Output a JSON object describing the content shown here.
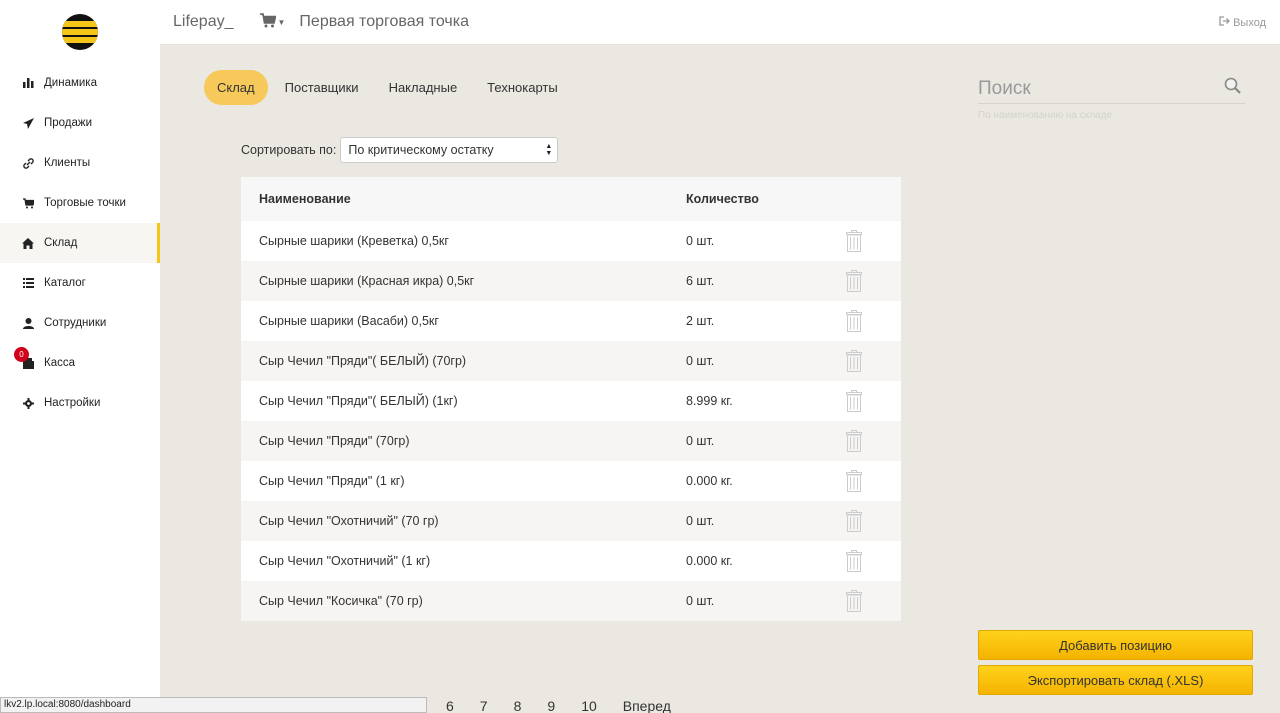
{
  "header": {
    "brand": "Lifepay_",
    "store_title": "Первая торговая точка",
    "logout_label": "Выход"
  },
  "sidebar": {
    "items": [
      {
        "label": "Динамика",
        "icon": "bar-chart-icon"
      },
      {
        "label": "Продажи",
        "icon": "paper-plane-icon"
      },
      {
        "label": "Клиенты",
        "icon": "link-icon"
      },
      {
        "label": "Торговые точки",
        "icon": "cart-icon"
      },
      {
        "label": "Склад",
        "icon": "home-icon",
        "active": true
      },
      {
        "label": "Каталог",
        "icon": "list-icon"
      },
      {
        "label": "Сотрудники",
        "icon": "user-icon"
      },
      {
        "label": "Касса",
        "icon": "register-icon",
        "badge": "0"
      },
      {
        "label": "Настройки",
        "icon": "gear-icon"
      }
    ]
  },
  "tabs": [
    {
      "label": "Склад",
      "active": true
    },
    {
      "label": "Поставщики"
    },
    {
      "label": "Накладные"
    },
    {
      "label": "Технокарты"
    }
  ],
  "sort": {
    "label": "Сортировать по:",
    "selected": "По критическому остатку"
  },
  "table": {
    "headers": {
      "name": "Наименование",
      "qty": "Количество"
    },
    "rows": [
      {
        "name": "Сырные шарики (Креветка) 0,5кг",
        "qty": "0 шт."
      },
      {
        "name": "Сырные шарики (Красная икра) 0,5кг",
        "qty": "6 шт."
      },
      {
        "name": "Сырные шарики (Васаби) 0,5кг",
        "qty": "2 шт."
      },
      {
        "name": "Сыр Чечил \"Пряди\"( БЕЛЫЙ) (70гр)",
        "qty": "0 шт."
      },
      {
        "name": "Сыр Чечил \"Пряди\"( БЕЛЫЙ) (1кг)",
        "qty": "8.999 кг."
      },
      {
        "name": "Сыр Чечил \"Пряди\" (70гр)",
        "qty": "0 шт."
      },
      {
        "name": "Сыр Чечил \"Пряди\" (1 кг)",
        "qty": "0.000 кг."
      },
      {
        "name": "Сыр Чечил \"Охотничий\" (70 гр)",
        "qty": "0 шт."
      },
      {
        "name": "Сыр Чечил \"Охотничий\" (1 кг)",
        "qty": "0.000 кг."
      },
      {
        "name": "Сыр Чечил \"Косичка\" (70 гр)",
        "qty": "0 шт."
      }
    ]
  },
  "search": {
    "placeholder": "Поиск",
    "hint": "По наименованию на складе"
  },
  "buttons": {
    "add": "Добавить позицию",
    "export": "Экспортировать склад (.XLS)"
  },
  "pagination": {
    "pages": [
      "6",
      "7",
      "8",
      "9",
      "10"
    ],
    "next": "Вперед"
  },
  "statusbar": {
    "url": "lkv2.lp.local:8080/dashboard"
  },
  "colors": {
    "accent": "#f5c518",
    "tab_active": "#f7c95a",
    "background": "#ebe8e2",
    "badge": "#d0021b"
  }
}
